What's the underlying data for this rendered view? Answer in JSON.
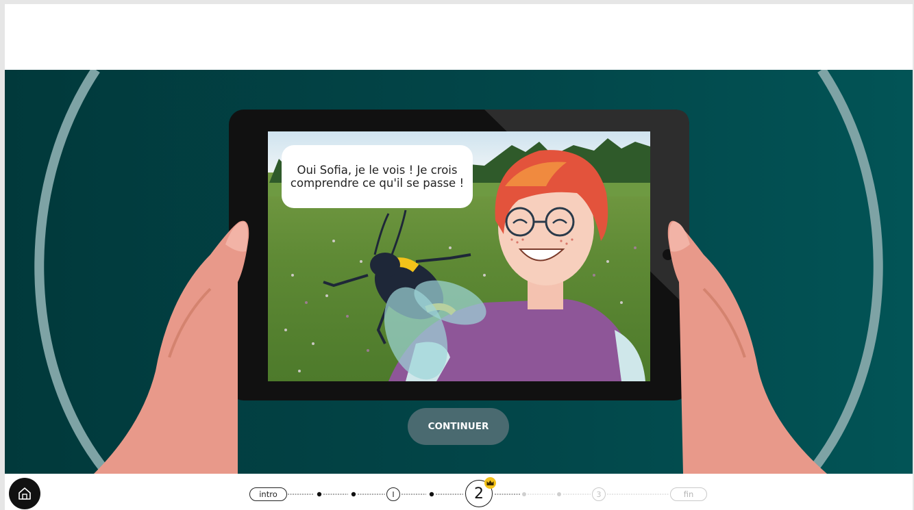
{
  "scene": {
    "speech_bubble": "Oui Sofia, je le vois ! Je crois comprendre ce qu'il se passe !"
  },
  "buttons": {
    "continue_label": "CONTINUER"
  },
  "progress": {
    "intro_label": "intro",
    "chapter1_label": "I",
    "chapter2_label": "2",
    "chapter3_label": "3",
    "end_label": "fin",
    "current_step": "2"
  },
  "icons": {
    "home": "home-icon",
    "crown": "crown-icon"
  },
  "colors": {
    "background": "#013d3f",
    "button": "#4a6a70",
    "badge": "#f3c21a",
    "hands": "#e8998a",
    "shirt": "#8e5698"
  }
}
